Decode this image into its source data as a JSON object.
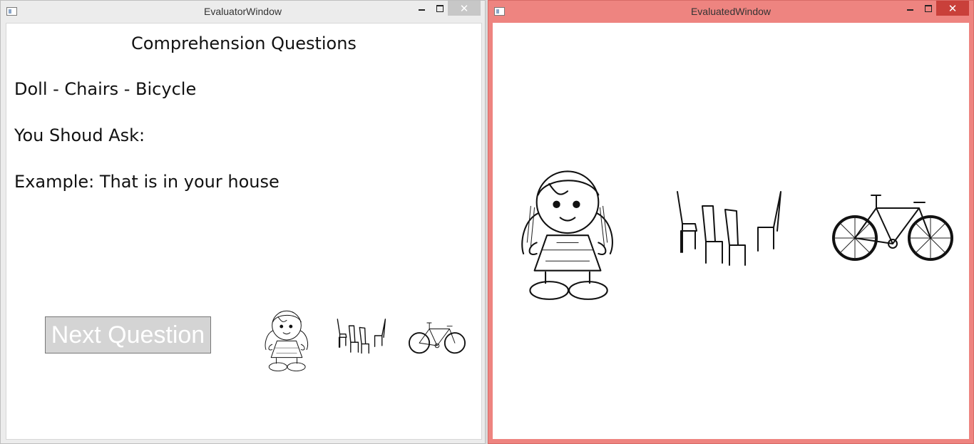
{
  "evaluator_window": {
    "title": "EvaluatorWindow",
    "heading": "Comprehension Questions",
    "items_line": "Doll - Chairs - Bicycle",
    "prompt_line": "You Shoud Ask:",
    "example_line": "Example: That is in your house",
    "next_button_label": "Next Question",
    "close_glyph": "✕",
    "thumbnails": [
      "doll-icon",
      "chairs-icon",
      "bicycle-icon"
    ]
  },
  "evaluated_window": {
    "title": "EvaluatedWindow",
    "close_glyph": "✕",
    "images": [
      "doll-icon",
      "chairs-icon",
      "bicycle-icon"
    ],
    "frame_color": "#ee8480"
  }
}
